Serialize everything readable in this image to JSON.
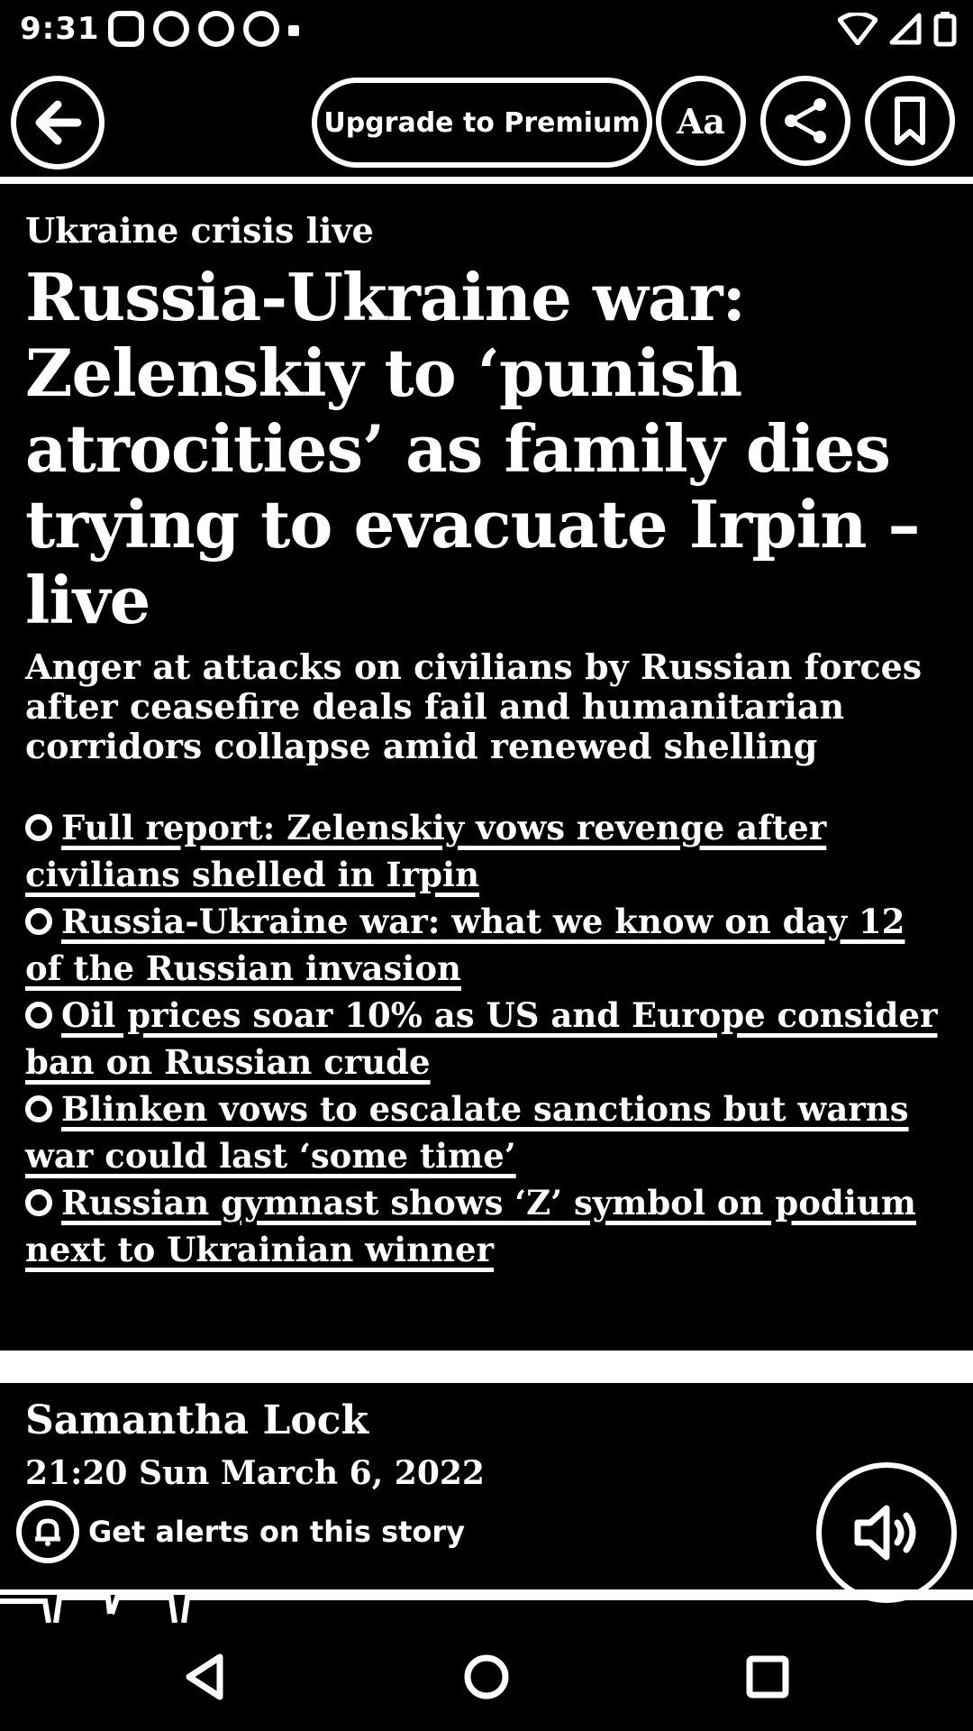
{
  "status_bar": {
    "time": "9:31"
  },
  "toolbar": {
    "premium_label": "Upgrade to Premium",
    "text_size_label": "Aa"
  },
  "article": {
    "kicker": "Ukraine crisis live",
    "headline": "Russia-Ukraine war: Zelenskiy to ‘punish atrocities’ as family dies trying to evacuate Irpin – live",
    "standfirst": "Anger at attacks on civilians by Russian forces after ceasefire deals fail and humanitarian corridors collapse amid renewed shelling",
    "links": [
      "Full report: Zelenskiy vows revenge after civilians shelled in Irpin",
      "Russia-Ukraine war: what we know on day 12 of the Russian invasion",
      "Oil prices soar 10% as US and Europe consider ban on Russian crude",
      "Blinken vows to escalate sanctions but warns war could last ‘some time’",
      "Russian gymnast shows ‘Z’ symbol on podium next to Ukrainian winner"
    ]
  },
  "byline": {
    "author": "Samantha Lock",
    "date": "21:20 Sun March 6, 2022"
  },
  "alerts": {
    "label": "Get alerts on this story"
  }
}
